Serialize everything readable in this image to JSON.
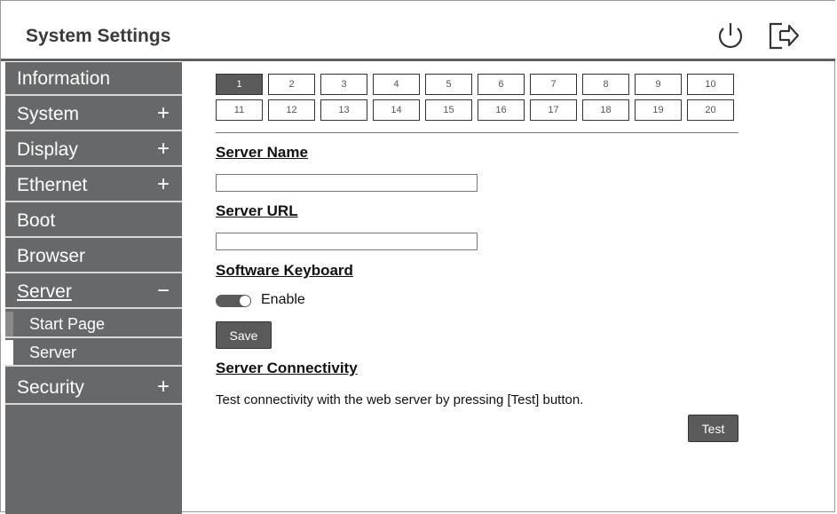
{
  "header": {
    "title": "System Settings",
    "icons": [
      "power-icon",
      "logout-icon"
    ]
  },
  "sidebar": {
    "items": [
      {
        "label": "Information",
        "sign": ""
      },
      {
        "label": "System",
        "sign": "+"
      },
      {
        "label": "Display",
        "sign": "+"
      },
      {
        "label": "Ethernet",
        "sign": "+"
      },
      {
        "label": "Boot",
        "sign": ""
      },
      {
        "label": "Browser",
        "sign": ""
      },
      {
        "label": "Server",
        "sign": "−",
        "expanded": true
      },
      {
        "label": "Security",
        "sign": "+"
      }
    ],
    "server_subitems": [
      {
        "label": "Start Page",
        "selected": false
      },
      {
        "label": "Server",
        "selected": true
      }
    ]
  },
  "pager": {
    "pages": [
      "1",
      "2",
      "3",
      "4",
      "5",
      "6",
      "7",
      "8",
      "9",
      "10",
      "11",
      "12",
      "13",
      "14",
      "15",
      "16",
      "17",
      "18",
      "19",
      "20"
    ],
    "selected": "1"
  },
  "main": {
    "server_name_title": "Server Name",
    "server_name_value": "",
    "server_url_title": "Server URL",
    "server_url_value": "",
    "software_keyboard_title": "Software Keyboard",
    "keyboard_toggle_label": "Enable",
    "keyboard_enabled": true,
    "save_label": "Save",
    "connectivity_title": "Server Connectivity",
    "connectivity_desc": "Test connectivity with the web server by pressing [Test] button.",
    "test_label": "Test"
  },
  "colors": {
    "sidebar_bg": "#666869",
    "button_bg": "#5a5a5a",
    "header_border": "#5f5f5f"
  }
}
